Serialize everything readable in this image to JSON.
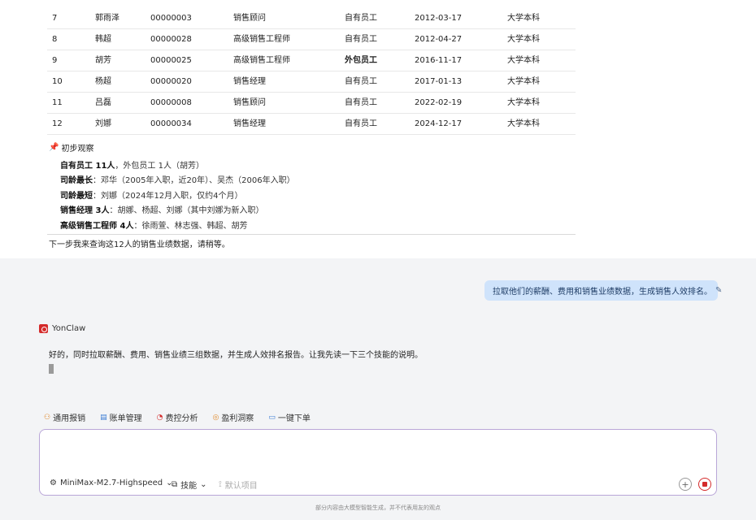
{
  "table": {
    "rows": [
      {
        "no": "7",
        "name": "郭雨泽",
        "id": "00000003",
        "position": "销售顾问",
        "type": "自有员工",
        "date": "2012-03-17",
        "edu": "大学本科"
      },
      {
        "no": "8",
        "name": "韩超",
        "id": "00000028",
        "position": "高级销售工程师",
        "type": "自有员工",
        "date": "2012-04-27",
        "edu": "大学本科"
      },
      {
        "no": "9",
        "name": "胡芳",
        "id": "00000025",
        "position": "高级销售工程师",
        "type": "外包员工",
        "date": "2016-11-17",
        "edu": "大学本科"
      },
      {
        "no": "10",
        "name": "杨超",
        "id": "00000020",
        "position": "销售经理",
        "type": "自有员工",
        "date": "2017-01-13",
        "edu": "大学本科"
      },
      {
        "no": "11",
        "name": "吕磊",
        "id": "00000008",
        "position": "销售顾问",
        "type": "自有员工",
        "date": "2022-02-19",
        "edu": "大学本科"
      },
      {
        "no": "12",
        "name": "刘娜",
        "id": "00000034",
        "position": "销售经理",
        "type": "自有员工",
        "date": "2024-12-17",
        "edu": "大学本科"
      }
    ]
  },
  "observation": {
    "title": "初步观察",
    "items": [
      {
        "label": "自有员工 11人",
        "text": "，外包员工 1人（胡芳）"
      },
      {
        "label": "司龄最长",
        "text": "：邓华（2005年入职，近20年）、吴杰（2006年入职）"
      },
      {
        "label": "司龄最短",
        "text": "：刘娜（2024年12月入职，仅约4个月）"
      },
      {
        "label": "销售经理 3人",
        "text": "：胡娜、杨超、刘娜（其中刘娜为新入职）"
      },
      {
        "label": "高级销售工程师 4人",
        "text": "：徐雨萱、林志强、韩超、胡芳"
      }
    ],
    "next_step": "下一步我来查询这12人的销售业绩数据，请稍等。"
  },
  "user_message": "拉取他们的薪酬、费用和销售业绩数据，生成销售人效排名。",
  "bot": {
    "name": "YonClaw",
    "message": "好的，同时拉取薪酬、费用、销售业绩三组数据，并生成人效排名报告。让我先读一下三个技能的说明。"
  },
  "quick_actions": [
    {
      "label": "通用报销",
      "icon": "⚇",
      "color": "#e08a2e"
    },
    {
      "label": "账单管理",
      "icon": "▤",
      "color": "#3b7bd4"
    },
    {
      "label": "费控分析",
      "icon": "◔",
      "color": "#d42a2a"
    },
    {
      "label": "盈利洞察",
      "icon": "◎",
      "color": "#e08a2e"
    },
    {
      "label": "一键下单",
      "icon": "▭",
      "color": "#3b7bd4"
    }
  ],
  "composer": {
    "model": "MiniMax-M2.7-Highspeed",
    "skill": "技能",
    "project": "默认项目"
  },
  "disclaimer": "部分内容由大模型智能生成，并不代表用友的观点"
}
